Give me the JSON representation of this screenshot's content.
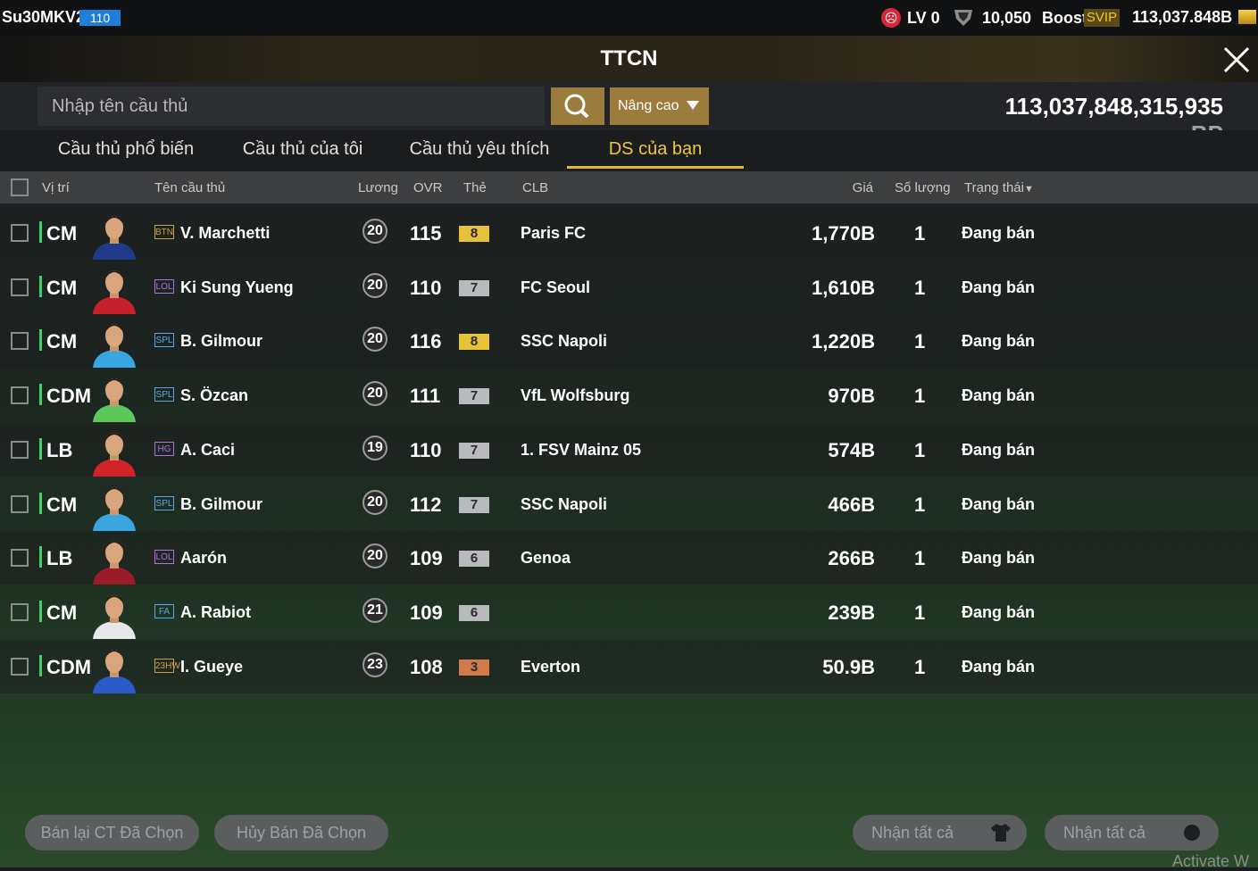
{
  "topbar": {
    "user_name": "Su30MKV2",
    "user_level": "110",
    "lv_text": "LV 0",
    "coins": "10,050",
    "boost_label": "Boost",
    "svip_label": "SVIP",
    "bp_balance": "113,037.848B"
  },
  "page": {
    "title": "TTCN"
  },
  "search": {
    "placeholder": "Nhập tên cầu thủ",
    "advanced_label": "Nâng cao",
    "bp_total": "113,037,848,315,935",
    "bp_unit": "BP"
  },
  "tabs": [
    {
      "label": "Cầu thủ phổ biến"
    },
    {
      "label": "Cầu thủ của tôi"
    },
    {
      "label": "Cầu thủ yêu thích"
    },
    {
      "label": "DS của bạn",
      "active": true
    }
  ],
  "columns": {
    "position": "Vị trí",
    "name": "Tên cầu thủ",
    "salary": "Lương",
    "ovr": "OVR",
    "grade": "Thẻ",
    "club": "CLB",
    "price": "Giá",
    "quantity": "Số lượng",
    "status": "Trạng thái"
  },
  "rows": [
    {
      "pos": "CM",
      "season": "BTN",
      "season_color": "#c9a14a",
      "name": "V. Marchetti",
      "salary": "20",
      "ovr": "115",
      "grade": "8",
      "grade_color": "#e6c23a",
      "club": "Paris FC",
      "price": "1,770B",
      "qty": "1",
      "status": "Đang bán",
      "kit": "#1f3c8a"
    },
    {
      "pos": "CM",
      "season": "LOL",
      "season_color": "#b070e0",
      "name": "Ki Sung Yueng",
      "salary": "20",
      "ovr": "110",
      "grade": "7",
      "grade_color": "#b8babd",
      "club": "FC Seoul",
      "price": "1,610B",
      "qty": "1",
      "status": "Đang bán",
      "kit": "#c8202a"
    },
    {
      "pos": "CM",
      "season": "SPL",
      "season_color": "#5aa8e8",
      "name": "B. Gilmour",
      "salary": "20",
      "ovr": "116",
      "grade": "8",
      "grade_color": "#e6c23a",
      "club": "SSC Napoli",
      "price": "1,220B",
      "qty": "1",
      "status": "Đang bán",
      "kit": "#3aa6e0"
    },
    {
      "pos": "CDM",
      "season": "SPL",
      "season_color": "#5aa8e8",
      "name": "S. Özcan",
      "salary": "20",
      "ovr": "111",
      "grade": "7",
      "grade_color": "#b8babd",
      "club": "VfL Wolfsburg",
      "price": "970B",
      "qty": "1",
      "status": "Đang bán",
      "kit": "#5cc85a"
    },
    {
      "pos": "LB",
      "season": "HG",
      "season_color": "#b070e0",
      "name": "A. Caci",
      "salary": "19",
      "ovr": "110",
      "grade": "7",
      "grade_color": "#b8babd",
      "club": "1. FSV Mainz 05",
      "price": "574B",
      "qty": "1",
      "status": "Đang bán",
      "kit": "#d2232a"
    },
    {
      "pos": "CM",
      "season": "SPL",
      "season_color": "#5aa8e8",
      "name": "B. Gilmour",
      "salary": "20",
      "ovr": "112",
      "grade": "7",
      "grade_color": "#b8babd",
      "club": "SSC Napoli",
      "price": "466B",
      "qty": "1",
      "status": "Đang bán",
      "kit": "#3aa6e0"
    },
    {
      "pos": "LB",
      "season": "LOL",
      "season_color": "#b070e0",
      "name": "Aarón",
      "salary": "20",
      "ovr": "109",
      "grade": "6",
      "grade_color": "#b8babd",
      "club": "Genoa",
      "price": "266B",
      "qty": "1",
      "status": "Đang bán",
      "kit": "#9a1c2a"
    },
    {
      "pos": "CM",
      "season": "FA",
      "season_color": "#5aa8e8",
      "name": "A. Rabiot",
      "salary": "21",
      "ovr": "109",
      "grade": "6",
      "grade_color": "#b8babd",
      "club": "",
      "price": "239B",
      "qty": "1",
      "status": "Đang bán",
      "kit": "#e8e8ea"
    },
    {
      "pos": "CDM",
      "season": "23HW",
      "season_color": "#c9a14a",
      "name": "I. Gueye",
      "salary": "23",
      "ovr": "108",
      "grade": "3",
      "grade_color": "#d27a4a",
      "club": "Everton",
      "price": "50.9B",
      "qty": "1",
      "status": "Đang bán",
      "kit": "#2a5ac8"
    }
  ],
  "bottom": {
    "resell_selected": "Bán lại CT Đã Chọn",
    "cancel_selected": "Hủy Bán Đã Chọn",
    "claim_all_1": "Nhận tất cả",
    "claim_all_2": "Nhận tất cả"
  },
  "watermark": "Activate W"
}
